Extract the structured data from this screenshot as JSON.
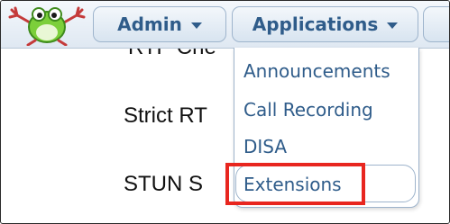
{
  "nav": {
    "logo_icon": "frog-logo-icon",
    "admin_label": "Admin",
    "applications_label": "Applications",
    "caret_icon": "caret-down-icon"
  },
  "background": {
    "label_rtp": "RTP Che",
    "label_strict": "Strict RT",
    "label_stun": "STUN S"
  },
  "applications_menu": {
    "items": [
      {
        "label": "Announcements"
      },
      {
        "label": "Call Recording"
      },
      {
        "label": "DISA"
      },
      {
        "label": "Extensions"
      }
    ],
    "highlighted_index": 3,
    "highlight_color": "#e8261f"
  },
  "colors": {
    "nav_text": "#2f5c8a",
    "nav_border": "#9eb4cc"
  }
}
